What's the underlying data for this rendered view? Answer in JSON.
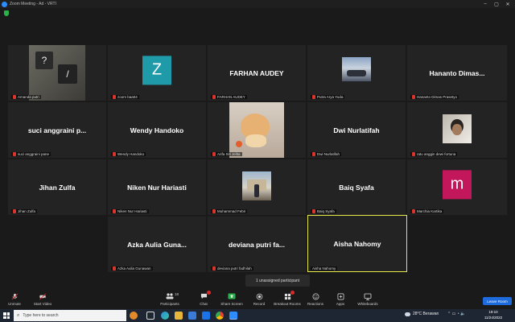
{
  "window": {
    "title": "Zoom Meeting - Ad - VRTI"
  },
  "window_controls": [
    "–",
    "▢",
    "✕"
  ],
  "participants": [
    {
      "display": "",
      "label": "Amanda putri"
    },
    {
      "display": "Z",
      "label": "zoom baa04",
      "avatar_color": "#1f9aa8"
    },
    {
      "display": "FARHAN AUDEY",
      "label": "FARHAN AUDEY"
    },
    {
      "display": "",
      "label": "Putra Arya Yuda"
    },
    {
      "display": "Hananto  Dimas...",
      "label": "Hananto Dimas Prasetyo"
    },
    {
      "display": "suci anggraini p...",
      "label": "suci anggraini pane"
    },
    {
      "display": "Wendy Handoko",
      "label": "Wendy Handoko"
    },
    {
      "display": "",
      "label": "Arifa Siti Jelita"
    },
    {
      "display": "Dwi Nurlatifah",
      "label": "Dwi Nurlatifah"
    },
    {
      "display": "",
      "label": "ratu anggin dewi fortuna"
    },
    {
      "display": "Jihan Zulfa",
      "label": "Jihan Zulfa"
    },
    {
      "display": "Niken Nur Hariasti",
      "label": "Niken Nur Hariasti"
    },
    {
      "display": "",
      "label": "Muhammad Febri"
    },
    {
      "display": "Baiq Syafa",
      "label": "Baiq Syafa"
    },
    {
      "display": "m",
      "label": "Marchia Kartika",
      "avatar_color": "#c2185b"
    },
    {
      "display": "Azka Aulia Guna...",
      "label": "Azka Aulia Gunawan"
    },
    {
      "display": "deviana putri fa...",
      "label": "deviana putri fadhilah"
    },
    {
      "display": "Aisha Nahomy",
      "label": "Aisha Nahomy"
    }
  ],
  "unassigned": "1 unassigned participant",
  "toolbar": {
    "unmute": "Unmute",
    "start_video": "Start Video",
    "participants": "Participants",
    "participants_count": "18",
    "chat": "Chat",
    "share_screen": "Share Screen",
    "record": "Record",
    "breakout_rooms": "Breakout Rooms",
    "reactions": "Reactions",
    "apps": "Apps",
    "whiteboards": "Whiteboards",
    "leave_room": "Leave Room"
  },
  "taskbar": {
    "search_placeholder": "Type here to search",
    "weather": "28°C  Berawan",
    "time": "19:10",
    "date": "11/24/2022"
  },
  "colors": {
    "accent": "#2d8cff",
    "active_speaker": "#e6e84a",
    "share_green": "#2bb14c",
    "muted_red": "#d9352b",
    "leave_blue": "#1d6bdd"
  }
}
